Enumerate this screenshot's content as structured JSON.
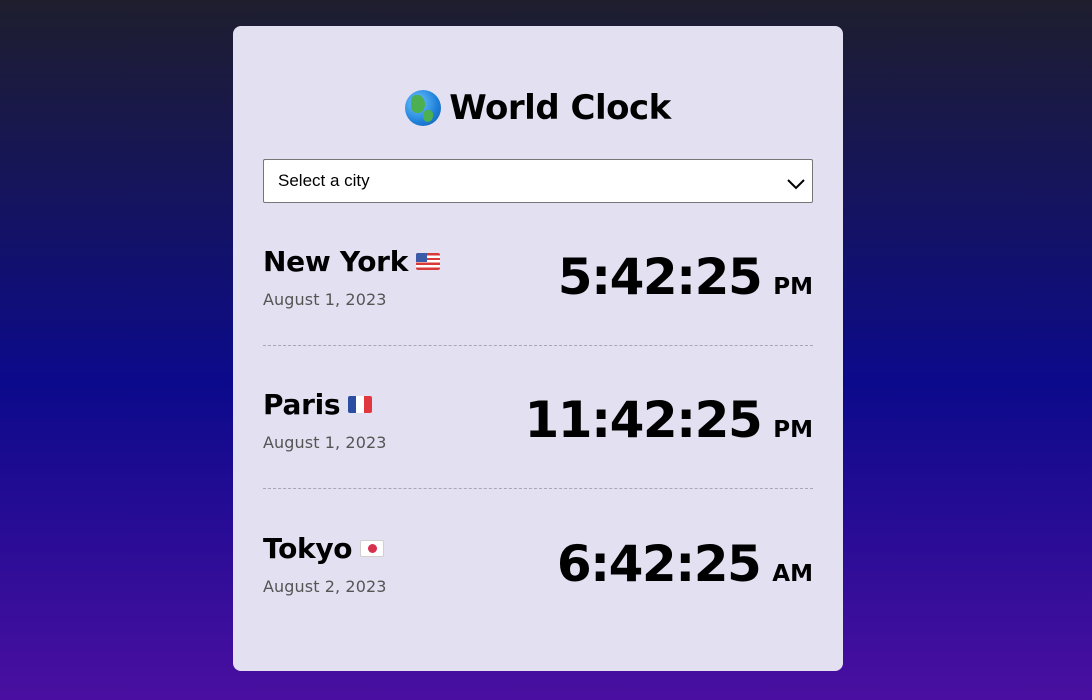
{
  "app": {
    "title": "World Clock",
    "globe_icon": "globe-icon"
  },
  "selector": {
    "value": "Select a city",
    "icon": "chevron-down-icon"
  },
  "colors": {
    "card_background": "#e3e0f1",
    "gradient_top": "#1e1e2e",
    "gradient_mid": "#0c0a8c",
    "gradient_bottom": "#4a0fa0"
  },
  "clocks": [
    {
      "city": "New York",
      "flag": "us-flag-icon",
      "date": "August 1, 2023",
      "time": "5:42:25",
      "period": "PM"
    },
    {
      "city": "Paris",
      "flag": "france-flag-icon",
      "date": "August 1, 2023",
      "time": "11:42:25",
      "period": "PM"
    },
    {
      "city": "Tokyo",
      "flag": "japan-flag-icon",
      "date": "August 2, 2023",
      "time": "6:42:25",
      "period": "AM"
    }
  ]
}
